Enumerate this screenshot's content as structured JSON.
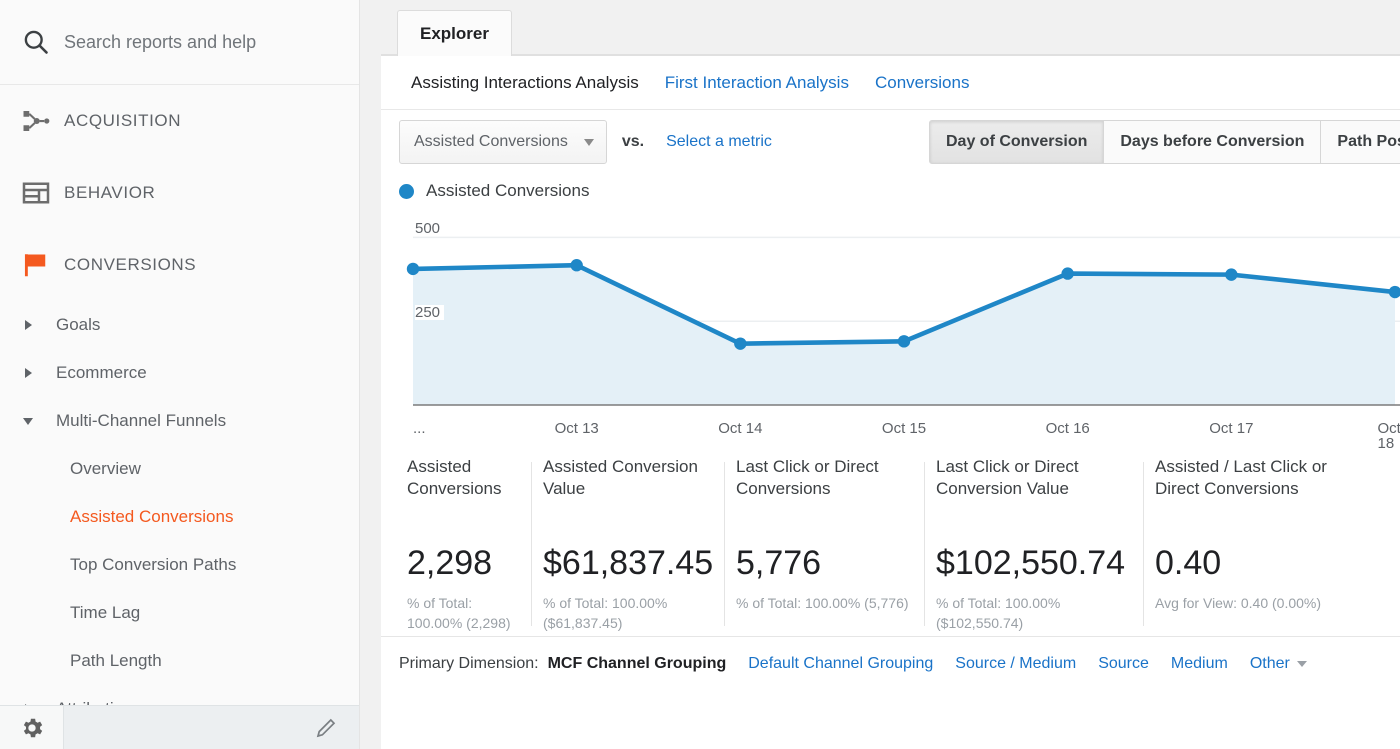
{
  "sidebar": {
    "search": {
      "placeholder": "Search reports and help",
      "icon": "search-icon"
    },
    "sections": [
      {
        "label": "ACQUISITION",
        "icon": "acquisition-icon"
      },
      {
        "label": "BEHAVIOR",
        "icon": "behavior-icon"
      },
      {
        "label": "CONVERSIONS",
        "icon": "conversions-flag-icon"
      }
    ],
    "items": [
      {
        "label": "Goals",
        "expander": "collapsed",
        "level": 1,
        "selected": false
      },
      {
        "label": "Ecommerce",
        "expander": "collapsed",
        "level": 1,
        "selected": false
      },
      {
        "label": "Multi-Channel Funnels",
        "expander": "expanded",
        "level": 1,
        "selected": false
      },
      {
        "label": "Overview",
        "expander": "none",
        "level": 2,
        "selected": false
      },
      {
        "label": "Assisted Conversions",
        "expander": "none",
        "level": 2,
        "selected": true
      },
      {
        "label": "Top Conversion Paths",
        "expander": "none",
        "level": 2,
        "selected": false
      },
      {
        "label": "Time Lag",
        "expander": "none",
        "level": 2,
        "selected": false
      },
      {
        "label": "Path Length",
        "expander": "none",
        "level": 2,
        "selected": false
      },
      {
        "label": "Attribution",
        "expander": "collapsed",
        "level": 1,
        "selected": false
      }
    ],
    "footer": {
      "gear": "gear-icon",
      "pencil": "pencil-edit-icon"
    },
    "selected_color": "#f4591f"
  },
  "tabs": [
    {
      "label": "Explorer",
      "active": true
    }
  ],
  "sublinks": [
    {
      "label": "Assisting Interactions Analysis",
      "active": true
    },
    {
      "label": "First Interaction Analysis",
      "active": false
    },
    {
      "label": "Conversions",
      "active": false
    }
  ],
  "controls": {
    "metric_select": {
      "value": "Assisted Conversions",
      "caret": "chevron-down-icon"
    },
    "vs_label": "vs.",
    "select_metric_link": "Select a metric",
    "toggles": [
      {
        "label": "Day of Conversion",
        "active": true
      },
      {
        "label": "Days before Conversion",
        "active": false
      },
      {
        "label": "Path Position",
        "active": false
      }
    ]
  },
  "legend": {
    "label": "Assisted Conversions",
    "color": "#1f87c7"
  },
  "chart_data": {
    "type": "area",
    "title": "Assisted Conversions",
    "series": [
      {
        "name": "Assisted Conversions",
        "color": "#1f87c7",
        "values": [
          406,
          417,
          183,
          190,
          392,
          389,
          337
        ]
      }
    ],
    "x": [
      "...",
      "Oct 13",
      "Oct 14",
      "Oct 15",
      "Oct 16",
      "Oct 17",
      "Oct 18"
    ],
    "xlabel": "",
    "ylabel": "",
    "ylim": [
      0,
      540
    ],
    "yticks": [
      250,
      500
    ],
    "grid": true,
    "legend_position": "top-left"
  },
  "cards": [
    {
      "title": "Assisted Conversions",
      "value": "2,298",
      "sub": "% of Total: 100.00% (2,298)"
    },
    {
      "title": "Assisted Conversion Value",
      "value": "$61,837.45",
      "sub": "% of Total: 100.00% ($61,837.45)"
    },
    {
      "title": "Last Click or Direct Conversions",
      "value": "5,776",
      "sub": "% of Total: 100.00% (5,776)"
    },
    {
      "title": "Last Click or Direct Conversion Value",
      "value": "$102,550.74",
      "sub": "% of Total: 100.00% ($102,550.74)"
    },
    {
      "title": "Assisted / Last Click or Direct Conversions",
      "value": "0.40",
      "sub": "Avg for View: 0.40 (0.00%)"
    }
  ],
  "primary_dimension": {
    "label": "Primary Dimension:",
    "active": "MCF Channel Grouping",
    "links": [
      "Default Channel Grouping",
      "Source / Medium",
      "Source",
      "Medium"
    ],
    "other": "Other"
  }
}
